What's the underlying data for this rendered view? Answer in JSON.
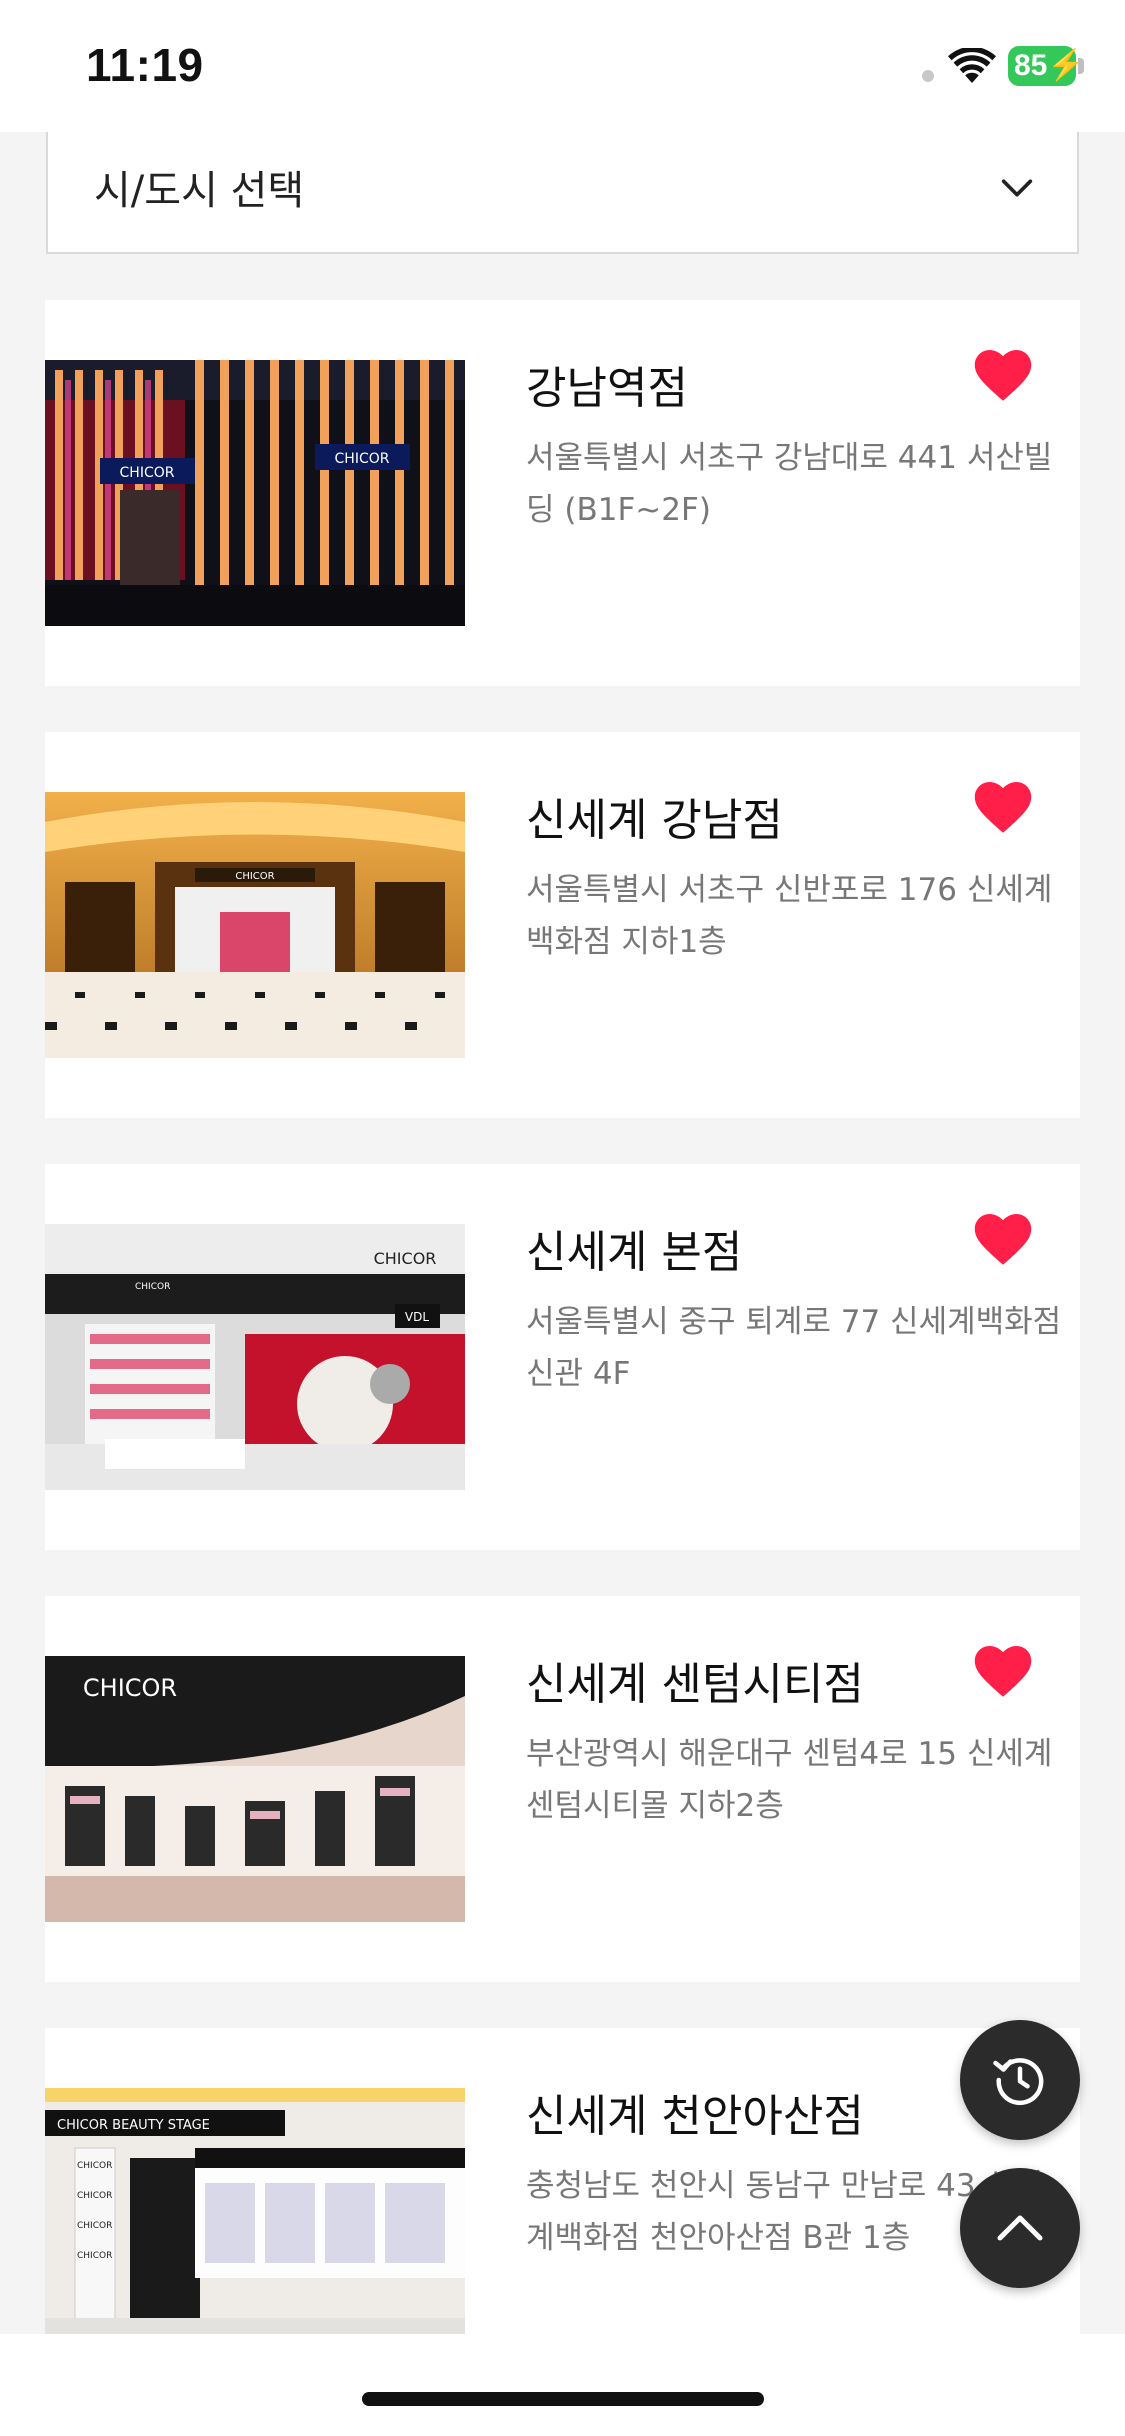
{
  "status_bar": {
    "time": "11:19",
    "battery": "85"
  },
  "city_select": {
    "label": "시/도시 선택",
    "icon": "chevron-down-icon"
  },
  "stores": [
    {
      "name": "강남역점",
      "address": "서울특별시 서초구 강남대로 441 서산빌딩 (B1F~2F)",
      "favorite": true
    },
    {
      "name": "신세계 강남점",
      "address": "서울특별시 서초구 신반포로 176 신세계 백화점 지하1층",
      "favorite": true
    },
    {
      "name": "신세계 본점",
      "address": "서울특별시 중구 퇴계로 77 신세계백화점 신관 4F",
      "favorite": true
    },
    {
      "name": "신세계 센텀시티점",
      "address": "부산광역시 해운대구 센텀4로 15 신세계센텀시티몰 지하2층",
      "favorite": true
    },
    {
      "name": "신세계 천안아산점",
      "address": "충청남도 천안시 동남구 만남로 43 신세계백화점 천안아산점 B관 1층",
      "favorite": false
    }
  ],
  "photo_signs": {
    "store_sign": "CHICOR",
    "beauty_stage": "CHICOR BEAUTY STAGE",
    "vdl": "VDL"
  },
  "floating_buttons": {
    "history": "history-icon",
    "scroll_top": "arrow-up-icon"
  },
  "colors": {
    "heart": "#ff1f48",
    "fab": "#2b2b2b",
    "battery": "#34c759"
  }
}
